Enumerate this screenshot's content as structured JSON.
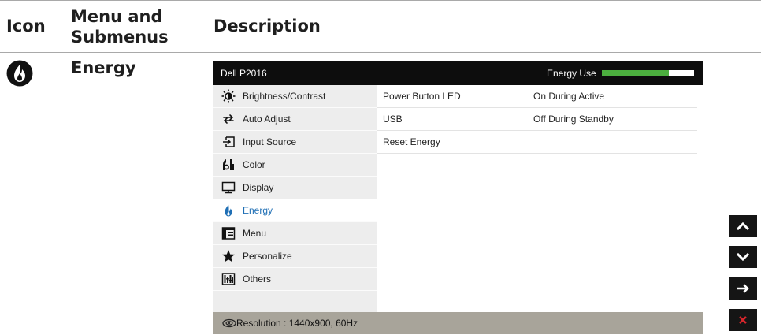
{
  "table_header": {
    "col_icon": "Icon",
    "col_menu_line1": "Menu and",
    "col_menu_line2": "Submenus",
    "col_description": "Description"
  },
  "section": {
    "title": "Energy",
    "icon": "energy-flame-icon"
  },
  "osd": {
    "model": "Dell P2016",
    "energy_use_label": "Energy Use",
    "energy_use_level": 0.73,
    "menu": [
      {
        "label": "Brightness/Contrast",
        "icon": "brightness-icon"
      },
      {
        "label": "Auto Adjust",
        "icon": "auto-adjust-icon"
      },
      {
        "label": "Input Source",
        "icon": "input-source-icon"
      },
      {
        "label": "Color",
        "icon": "color-icon"
      },
      {
        "label": "Display",
        "icon": "display-icon"
      },
      {
        "label": "Energy",
        "icon": "energy-icon",
        "active": true
      },
      {
        "label": "Menu",
        "icon": "menu-icon"
      },
      {
        "label": "Personalize",
        "icon": "star-icon"
      },
      {
        "label": "Others",
        "icon": "others-icon"
      }
    ],
    "settings": [
      {
        "name": "Power Button LED",
        "value": "On During Active"
      },
      {
        "name": "USB",
        "value": "Off During Standby"
      },
      {
        "name": "Reset Energy",
        "value": ""
      }
    ],
    "resolution_text": "Resolution : 1440x900, 60Hz",
    "accent_color": "#1f6fb5",
    "energy_bar_color": "#4caf3f"
  },
  "nav_buttons": [
    "up-arrow-icon",
    "down-arrow-icon",
    "right-arrow-icon",
    "close-icon"
  ]
}
